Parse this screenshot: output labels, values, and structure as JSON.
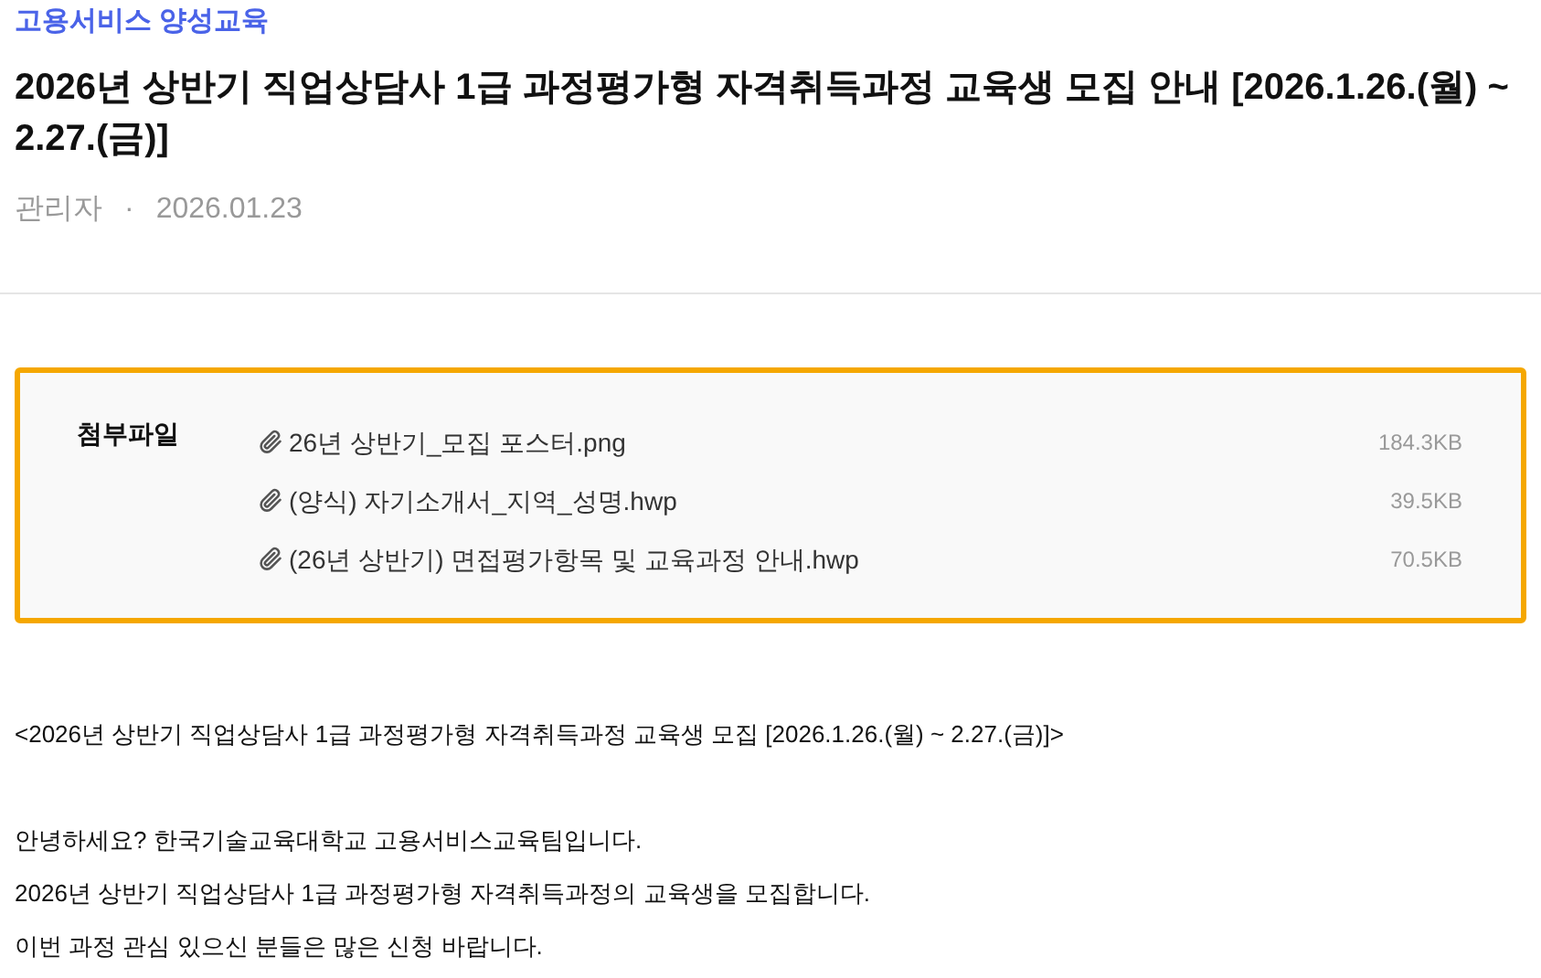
{
  "category": "고용서비스 양성교육",
  "title": "2026년 상반기 직업상담사 1급 과정평가형 자격취득과정 교육생 모집 안내 [2026.1.26.(월) ~ 2.27.(금)]",
  "meta": {
    "author": "관리자",
    "separator": "·",
    "date": "2026.01.23"
  },
  "attachments": {
    "label": "첨부파일",
    "files": [
      {
        "name": "26년 상반기_모집 포스터.png",
        "size": "184.3KB"
      },
      {
        "name": "(양식) 자기소개서_지역_성명.hwp",
        "size": "39.5KB"
      },
      {
        "name": "(26년 상반기) 면접평가항목 및 교육과정 안내.hwp",
        "size": "70.5KB"
      }
    ]
  },
  "body": [
    [
      "<2026년 상반기 직업상담사 1급 과정평가형 자격취득과정 교육생 모집 [2026.1.26.(월) ~ 2.27.(금)]>"
    ],
    [
      "안녕하세요? 한국기술교육대학교 고용서비스교육팀입니다.",
      "2026년 상반기 직업상담사 1급 과정평가형 자격취득과정의 교육생을 모집합니다.",
      "이번 과정 관심 있으신 분들은 많은 신청 바랍니다."
    ]
  ]
}
